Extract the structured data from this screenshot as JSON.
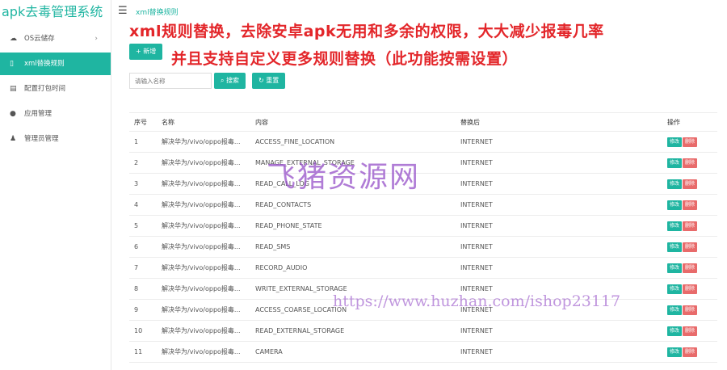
{
  "brand": {
    "title": "apk去毒管理系统"
  },
  "header": {
    "breadcrumb": "xml替换规则"
  },
  "sidebar": {
    "items": [
      {
        "icon": "cloud-icon",
        "label": "OS云储存",
        "has_arrow": true
      },
      {
        "icon": "file-icon",
        "label": "xml替换规则",
        "active": true
      },
      {
        "icon": "clipboard-icon",
        "label": "配置打包时间"
      },
      {
        "icon": "android-icon",
        "label": "应用管理"
      },
      {
        "icon": "user-icon",
        "label": "管理员管理"
      }
    ]
  },
  "promo": {
    "line1": "xml规则替换，去除安卓apk无用和多余的权限，大大减少报毒几率",
    "line2": "并且支持自定义更多规则替换（此功能按需设置）"
  },
  "toolbar": {
    "add_label": "+ 新增",
    "search_placeholder": "请输入名称",
    "search_label": "搜索",
    "reset_label": "重置"
  },
  "table": {
    "headers": {
      "no": "序号",
      "name": "名称",
      "content": "内容",
      "replacement": "替换后",
      "actions": "操作"
    },
    "edit_label": "修改",
    "delete_label": "删除",
    "rows": [
      {
        "no": "1",
        "name": "解决华为/vivo/oppo报毒...",
        "content": "ACCESS_FINE_LOCATION",
        "replacement": "INTERNET"
      },
      {
        "no": "2",
        "name": "解决华为/vivo/oppo报毒...",
        "content": "MANAGE_EXTERNAL_STORAGE",
        "replacement": "INTERNET"
      },
      {
        "no": "3",
        "name": "解决华为/vivo/oppo报毒...",
        "content": "READ_CALL_LOG",
        "replacement": "INTERNET"
      },
      {
        "no": "4",
        "name": "解决华为/vivo/oppo报毒...",
        "content": "READ_CONTACTS",
        "replacement": "INTERNET"
      },
      {
        "no": "5",
        "name": "解决华为/vivo/oppo报毒...",
        "content": "READ_PHONE_STATE",
        "replacement": "INTERNET"
      },
      {
        "no": "6",
        "name": "解决华为/vivo/oppo报毒...",
        "content": "READ_SMS",
        "replacement": "INTERNET"
      },
      {
        "no": "7",
        "name": "解决华为/vivo/oppo报毒...",
        "content": "RECORD_AUDIO",
        "replacement": "INTERNET"
      },
      {
        "no": "8",
        "name": "解决华为/vivo/oppo报毒...",
        "content": "WRITE_EXTERNAL_STORAGE",
        "replacement": "INTERNET"
      },
      {
        "no": "9",
        "name": "解决华为/vivo/oppo报毒...",
        "content": "ACCESS_COARSE_LOCATION",
        "replacement": "INTERNET"
      },
      {
        "no": "10",
        "name": "解决华为/vivo/oppo报毒...",
        "content": "READ_EXTERNAL_STORAGE",
        "replacement": "INTERNET"
      },
      {
        "no": "11",
        "name": "解决华为/vivo/oppo报毒...",
        "content": "CAMERA",
        "replacement": "INTERNET"
      }
    ]
  },
  "watermark": {
    "text1": "飞猪资源网",
    "text2": "https://www.huzhan.com/ishop23117"
  },
  "colors": {
    "accent": "#1fb5a1",
    "danger": "#e86b6b",
    "promo": "#e3262a"
  }
}
